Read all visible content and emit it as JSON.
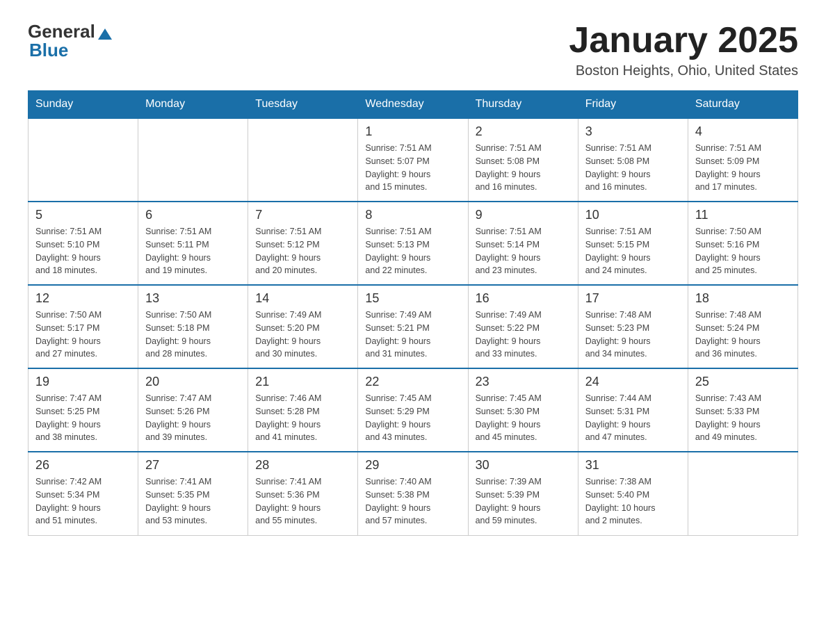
{
  "logo": {
    "general": "General",
    "arrow": "▲",
    "blue": "Blue"
  },
  "header": {
    "title": "January 2025",
    "subtitle": "Boston Heights, Ohio, United States"
  },
  "days_of_week": [
    "Sunday",
    "Monday",
    "Tuesday",
    "Wednesday",
    "Thursday",
    "Friday",
    "Saturday"
  ],
  "weeks": [
    [
      {
        "day": "",
        "info": ""
      },
      {
        "day": "",
        "info": ""
      },
      {
        "day": "",
        "info": ""
      },
      {
        "day": "1",
        "info": "Sunrise: 7:51 AM\nSunset: 5:07 PM\nDaylight: 9 hours\nand 15 minutes."
      },
      {
        "day": "2",
        "info": "Sunrise: 7:51 AM\nSunset: 5:08 PM\nDaylight: 9 hours\nand 16 minutes."
      },
      {
        "day": "3",
        "info": "Sunrise: 7:51 AM\nSunset: 5:08 PM\nDaylight: 9 hours\nand 16 minutes."
      },
      {
        "day": "4",
        "info": "Sunrise: 7:51 AM\nSunset: 5:09 PM\nDaylight: 9 hours\nand 17 minutes."
      }
    ],
    [
      {
        "day": "5",
        "info": "Sunrise: 7:51 AM\nSunset: 5:10 PM\nDaylight: 9 hours\nand 18 minutes."
      },
      {
        "day": "6",
        "info": "Sunrise: 7:51 AM\nSunset: 5:11 PM\nDaylight: 9 hours\nand 19 minutes."
      },
      {
        "day": "7",
        "info": "Sunrise: 7:51 AM\nSunset: 5:12 PM\nDaylight: 9 hours\nand 20 minutes."
      },
      {
        "day": "8",
        "info": "Sunrise: 7:51 AM\nSunset: 5:13 PM\nDaylight: 9 hours\nand 22 minutes."
      },
      {
        "day": "9",
        "info": "Sunrise: 7:51 AM\nSunset: 5:14 PM\nDaylight: 9 hours\nand 23 minutes."
      },
      {
        "day": "10",
        "info": "Sunrise: 7:51 AM\nSunset: 5:15 PM\nDaylight: 9 hours\nand 24 minutes."
      },
      {
        "day": "11",
        "info": "Sunrise: 7:50 AM\nSunset: 5:16 PM\nDaylight: 9 hours\nand 25 minutes."
      }
    ],
    [
      {
        "day": "12",
        "info": "Sunrise: 7:50 AM\nSunset: 5:17 PM\nDaylight: 9 hours\nand 27 minutes."
      },
      {
        "day": "13",
        "info": "Sunrise: 7:50 AM\nSunset: 5:18 PM\nDaylight: 9 hours\nand 28 minutes."
      },
      {
        "day": "14",
        "info": "Sunrise: 7:49 AM\nSunset: 5:20 PM\nDaylight: 9 hours\nand 30 minutes."
      },
      {
        "day": "15",
        "info": "Sunrise: 7:49 AM\nSunset: 5:21 PM\nDaylight: 9 hours\nand 31 minutes."
      },
      {
        "day": "16",
        "info": "Sunrise: 7:49 AM\nSunset: 5:22 PM\nDaylight: 9 hours\nand 33 minutes."
      },
      {
        "day": "17",
        "info": "Sunrise: 7:48 AM\nSunset: 5:23 PM\nDaylight: 9 hours\nand 34 minutes."
      },
      {
        "day": "18",
        "info": "Sunrise: 7:48 AM\nSunset: 5:24 PM\nDaylight: 9 hours\nand 36 minutes."
      }
    ],
    [
      {
        "day": "19",
        "info": "Sunrise: 7:47 AM\nSunset: 5:25 PM\nDaylight: 9 hours\nand 38 minutes."
      },
      {
        "day": "20",
        "info": "Sunrise: 7:47 AM\nSunset: 5:26 PM\nDaylight: 9 hours\nand 39 minutes."
      },
      {
        "day": "21",
        "info": "Sunrise: 7:46 AM\nSunset: 5:28 PM\nDaylight: 9 hours\nand 41 minutes."
      },
      {
        "day": "22",
        "info": "Sunrise: 7:45 AM\nSunset: 5:29 PM\nDaylight: 9 hours\nand 43 minutes."
      },
      {
        "day": "23",
        "info": "Sunrise: 7:45 AM\nSunset: 5:30 PM\nDaylight: 9 hours\nand 45 minutes."
      },
      {
        "day": "24",
        "info": "Sunrise: 7:44 AM\nSunset: 5:31 PM\nDaylight: 9 hours\nand 47 minutes."
      },
      {
        "day": "25",
        "info": "Sunrise: 7:43 AM\nSunset: 5:33 PM\nDaylight: 9 hours\nand 49 minutes."
      }
    ],
    [
      {
        "day": "26",
        "info": "Sunrise: 7:42 AM\nSunset: 5:34 PM\nDaylight: 9 hours\nand 51 minutes."
      },
      {
        "day": "27",
        "info": "Sunrise: 7:41 AM\nSunset: 5:35 PM\nDaylight: 9 hours\nand 53 minutes."
      },
      {
        "day": "28",
        "info": "Sunrise: 7:41 AM\nSunset: 5:36 PM\nDaylight: 9 hours\nand 55 minutes."
      },
      {
        "day": "29",
        "info": "Sunrise: 7:40 AM\nSunset: 5:38 PM\nDaylight: 9 hours\nand 57 minutes."
      },
      {
        "day": "30",
        "info": "Sunrise: 7:39 AM\nSunset: 5:39 PM\nDaylight: 9 hours\nand 59 minutes."
      },
      {
        "day": "31",
        "info": "Sunrise: 7:38 AM\nSunset: 5:40 PM\nDaylight: 10 hours\nand 2 minutes."
      },
      {
        "day": "",
        "info": ""
      }
    ]
  ]
}
